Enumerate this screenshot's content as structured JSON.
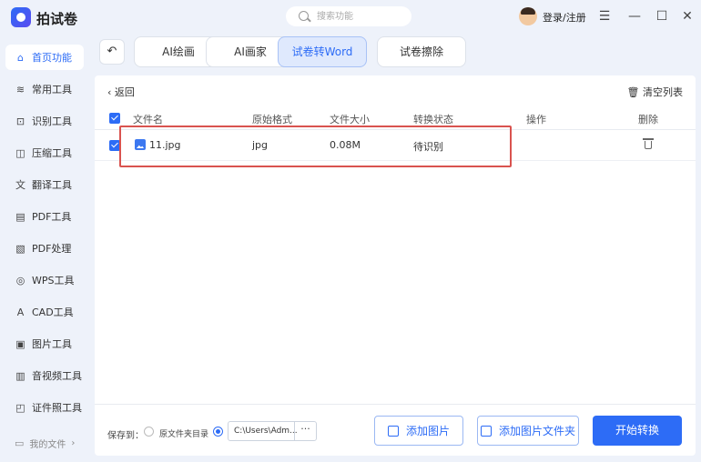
{
  "app": {
    "title": "拍试卷"
  },
  "search": {
    "placeholder": "搜索功能"
  },
  "header": {
    "login_label": "登录/注册"
  },
  "sidebar": {
    "items": [
      {
        "label": "首页功能",
        "icon": "home-icon"
      },
      {
        "label": "常用工具",
        "icon": "layers-icon"
      },
      {
        "label": "识别工具",
        "icon": "scan-icon"
      },
      {
        "label": "压缩工具",
        "icon": "compress-icon"
      },
      {
        "label": "翻译工具",
        "icon": "translate-icon"
      },
      {
        "label": "PDF工具",
        "icon": "pdf-icon"
      },
      {
        "label": "PDF处理",
        "icon": "pdf-process-icon"
      },
      {
        "label": "WPS工具",
        "icon": "wps-icon"
      },
      {
        "label": "CAD工具",
        "icon": "cad-icon"
      },
      {
        "label": "图片工具",
        "icon": "image-icon"
      },
      {
        "label": "音视频工具",
        "icon": "media-icon"
      },
      {
        "label": "证件照工具",
        "icon": "id-photo-icon"
      }
    ],
    "my_files": "我的文件"
  },
  "tabs": [
    {
      "label": "AI绘画"
    },
    {
      "label": "AI画家"
    },
    {
      "label": "试卷转Word"
    },
    {
      "label": "试卷擦除"
    }
  ],
  "main": {
    "return_label": "返回",
    "clear_label": "清空列表",
    "columns": [
      "文件名",
      "原始格式",
      "文件大小",
      "转换状态",
      "操作",
      "删除"
    ],
    "rows": [
      {
        "name": "11.jpg",
        "format": "jpg",
        "size": "0.08M",
        "status": "待识别"
      }
    ]
  },
  "bottom": {
    "save_to": "保存到：",
    "option_source": "原文件夹目录",
    "path": "C:\\Users\\Adm...",
    "path_more": "···",
    "add_image": "添加图片",
    "add_folder": "添加图片文件夹",
    "start": "开始转换"
  },
  "colors": {
    "accent": "#2d6cf6",
    "highlight": "#d9534f"
  }
}
